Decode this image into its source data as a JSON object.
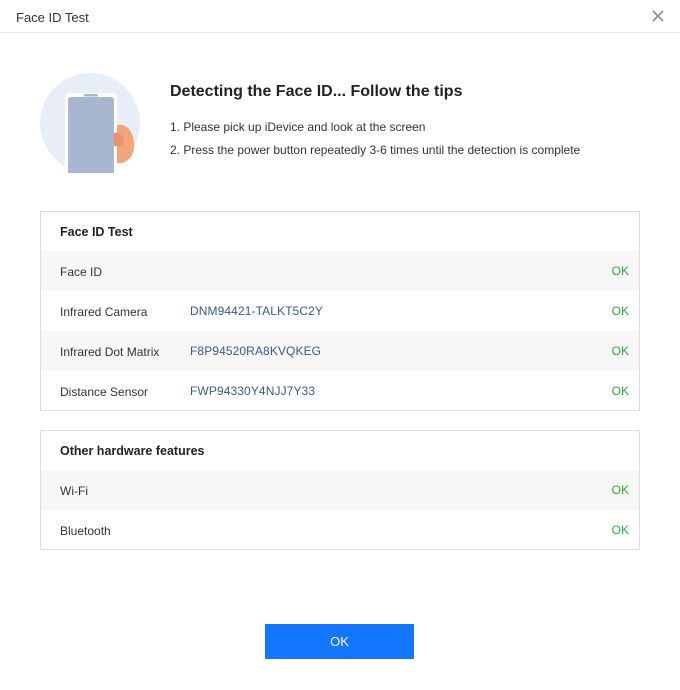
{
  "window": {
    "title": "Face ID Test"
  },
  "icons": {
    "close": "close-icon",
    "illustration": "phone-in-hand-illustration"
  },
  "instructions": {
    "heading": "Detecting the Face ID... Follow the tips",
    "tips": [
      "1. Please pick up iDevice and look at the screen",
      "2. Press the power button repeatedly 3-6 times until the detection is complete"
    ]
  },
  "face_id_panel": {
    "title": "Face ID Test",
    "rows": [
      {
        "label": "Face ID",
        "serial": "",
        "status": "OK"
      },
      {
        "label": "Infrared Camera",
        "serial": "DNM94421-TALKT5C2Y",
        "status": "OK"
      },
      {
        "label": "Infrared Dot Matrix",
        "serial": "F8P94520RA8KVQKEG",
        "status": "OK"
      },
      {
        "label": "Distance Sensor",
        "serial": "FWP94330Y4NJJ7Y33",
        "status": "OK"
      }
    ]
  },
  "hardware_panel": {
    "title": "Other hardware features",
    "rows": [
      {
        "label": "Wi-Fi",
        "status": "OK"
      },
      {
        "label": "Bluetooth",
        "status": "OK"
      }
    ]
  },
  "ok_button": {
    "label": "OK"
  },
  "colors": {
    "accent": "#1475ff",
    "ok_status": "#2aa836",
    "serial_text": "#3a5a86"
  }
}
